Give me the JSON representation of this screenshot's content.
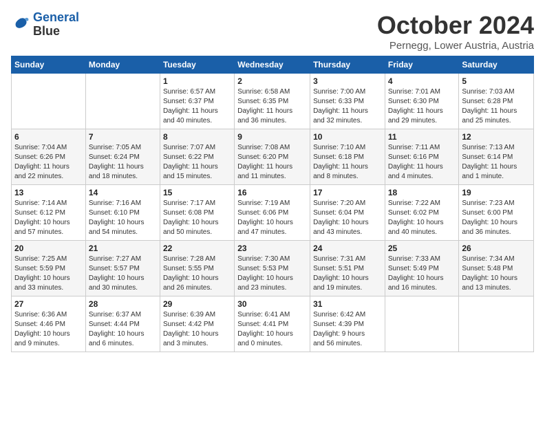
{
  "logo": {
    "line1": "General",
    "line2": "Blue"
  },
  "header": {
    "month": "October 2024",
    "location": "Pernegg, Lower Austria, Austria"
  },
  "weekdays": [
    "Sunday",
    "Monday",
    "Tuesday",
    "Wednesday",
    "Thursday",
    "Friday",
    "Saturday"
  ],
  "weeks": [
    [
      {
        "day": "",
        "info": ""
      },
      {
        "day": "",
        "info": ""
      },
      {
        "day": "1",
        "info": "Sunrise: 6:57 AM\nSunset: 6:37 PM\nDaylight: 11 hours\nand 40 minutes."
      },
      {
        "day": "2",
        "info": "Sunrise: 6:58 AM\nSunset: 6:35 PM\nDaylight: 11 hours\nand 36 minutes."
      },
      {
        "day": "3",
        "info": "Sunrise: 7:00 AM\nSunset: 6:33 PM\nDaylight: 11 hours\nand 32 minutes."
      },
      {
        "day": "4",
        "info": "Sunrise: 7:01 AM\nSunset: 6:30 PM\nDaylight: 11 hours\nand 29 minutes."
      },
      {
        "day": "5",
        "info": "Sunrise: 7:03 AM\nSunset: 6:28 PM\nDaylight: 11 hours\nand 25 minutes."
      }
    ],
    [
      {
        "day": "6",
        "info": "Sunrise: 7:04 AM\nSunset: 6:26 PM\nDaylight: 11 hours\nand 22 minutes."
      },
      {
        "day": "7",
        "info": "Sunrise: 7:05 AM\nSunset: 6:24 PM\nDaylight: 11 hours\nand 18 minutes."
      },
      {
        "day": "8",
        "info": "Sunrise: 7:07 AM\nSunset: 6:22 PM\nDaylight: 11 hours\nand 15 minutes."
      },
      {
        "day": "9",
        "info": "Sunrise: 7:08 AM\nSunset: 6:20 PM\nDaylight: 11 hours\nand 11 minutes."
      },
      {
        "day": "10",
        "info": "Sunrise: 7:10 AM\nSunset: 6:18 PM\nDaylight: 11 hours\nand 8 minutes."
      },
      {
        "day": "11",
        "info": "Sunrise: 7:11 AM\nSunset: 6:16 PM\nDaylight: 11 hours\nand 4 minutes."
      },
      {
        "day": "12",
        "info": "Sunrise: 7:13 AM\nSunset: 6:14 PM\nDaylight: 11 hours\nand 1 minute."
      }
    ],
    [
      {
        "day": "13",
        "info": "Sunrise: 7:14 AM\nSunset: 6:12 PM\nDaylight: 10 hours\nand 57 minutes."
      },
      {
        "day": "14",
        "info": "Sunrise: 7:16 AM\nSunset: 6:10 PM\nDaylight: 10 hours\nand 54 minutes."
      },
      {
        "day": "15",
        "info": "Sunrise: 7:17 AM\nSunset: 6:08 PM\nDaylight: 10 hours\nand 50 minutes."
      },
      {
        "day": "16",
        "info": "Sunrise: 7:19 AM\nSunset: 6:06 PM\nDaylight: 10 hours\nand 47 minutes."
      },
      {
        "day": "17",
        "info": "Sunrise: 7:20 AM\nSunset: 6:04 PM\nDaylight: 10 hours\nand 43 minutes."
      },
      {
        "day": "18",
        "info": "Sunrise: 7:22 AM\nSunset: 6:02 PM\nDaylight: 10 hours\nand 40 minutes."
      },
      {
        "day": "19",
        "info": "Sunrise: 7:23 AM\nSunset: 6:00 PM\nDaylight: 10 hours\nand 36 minutes."
      }
    ],
    [
      {
        "day": "20",
        "info": "Sunrise: 7:25 AM\nSunset: 5:59 PM\nDaylight: 10 hours\nand 33 minutes."
      },
      {
        "day": "21",
        "info": "Sunrise: 7:27 AM\nSunset: 5:57 PM\nDaylight: 10 hours\nand 30 minutes."
      },
      {
        "day": "22",
        "info": "Sunrise: 7:28 AM\nSunset: 5:55 PM\nDaylight: 10 hours\nand 26 minutes."
      },
      {
        "day": "23",
        "info": "Sunrise: 7:30 AM\nSunset: 5:53 PM\nDaylight: 10 hours\nand 23 minutes."
      },
      {
        "day": "24",
        "info": "Sunrise: 7:31 AM\nSunset: 5:51 PM\nDaylight: 10 hours\nand 19 minutes."
      },
      {
        "day": "25",
        "info": "Sunrise: 7:33 AM\nSunset: 5:49 PM\nDaylight: 10 hours\nand 16 minutes."
      },
      {
        "day": "26",
        "info": "Sunrise: 7:34 AM\nSunset: 5:48 PM\nDaylight: 10 hours\nand 13 minutes."
      }
    ],
    [
      {
        "day": "27",
        "info": "Sunrise: 6:36 AM\nSunset: 4:46 PM\nDaylight: 10 hours\nand 9 minutes."
      },
      {
        "day": "28",
        "info": "Sunrise: 6:37 AM\nSunset: 4:44 PM\nDaylight: 10 hours\nand 6 minutes."
      },
      {
        "day": "29",
        "info": "Sunrise: 6:39 AM\nSunset: 4:42 PM\nDaylight: 10 hours\nand 3 minutes."
      },
      {
        "day": "30",
        "info": "Sunrise: 6:41 AM\nSunset: 4:41 PM\nDaylight: 10 hours\nand 0 minutes."
      },
      {
        "day": "31",
        "info": "Sunrise: 6:42 AM\nSunset: 4:39 PM\nDaylight: 9 hours\nand 56 minutes."
      },
      {
        "day": "",
        "info": ""
      },
      {
        "day": "",
        "info": ""
      }
    ]
  ]
}
